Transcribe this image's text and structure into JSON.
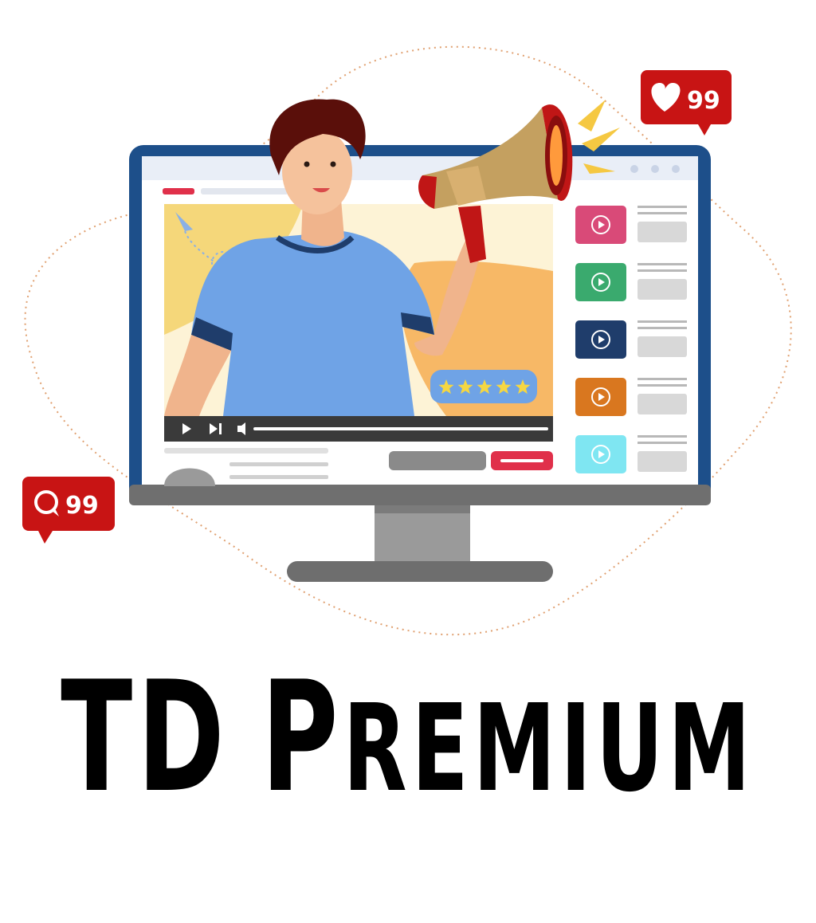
{
  "brand": {
    "title_part1": "TD",
    "title_part2_initial": "P",
    "title_part2_rest": "REMIUM"
  },
  "badges": {
    "likes": {
      "icon": "heart-icon",
      "count": "99",
      "color": "#c81414"
    },
    "comments": {
      "icon": "speech-bubble-icon",
      "count": "99",
      "color": "#c81414"
    }
  },
  "video": {
    "rating_stars": 5
  },
  "playlist": {
    "thumbnail_colors": [
      "#d94a78",
      "#3aaa6e",
      "#1f3d6b",
      "#d9771f",
      "#7fe6f2"
    ]
  },
  "colors": {
    "monitor_frame": "#1d4f8a",
    "monitor_stand": "#8a8a8a",
    "accent_red": "#e0304a",
    "shirt_blue": "#6fa3e6"
  }
}
